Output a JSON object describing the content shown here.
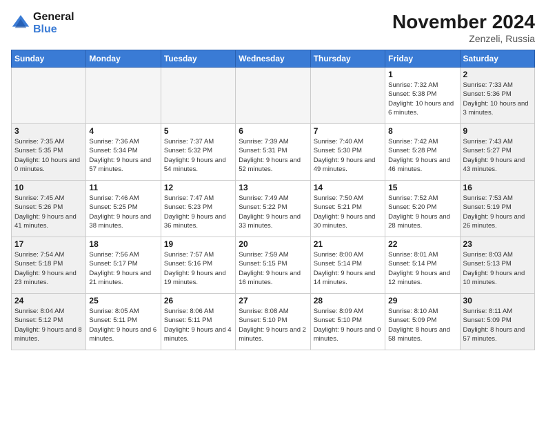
{
  "header": {
    "logo_line1": "General",
    "logo_line2": "Blue",
    "month": "November 2024",
    "location": "Zenzeli, Russia"
  },
  "weekdays": [
    "Sunday",
    "Monday",
    "Tuesday",
    "Wednesday",
    "Thursday",
    "Friday",
    "Saturday"
  ],
  "weeks": [
    [
      {
        "day": "",
        "empty": true
      },
      {
        "day": "",
        "empty": true
      },
      {
        "day": "",
        "empty": true
      },
      {
        "day": "",
        "empty": true
      },
      {
        "day": "",
        "empty": true
      },
      {
        "day": "1",
        "sunrise": "Sunrise: 7:32 AM",
        "sunset": "Sunset: 5:38 PM",
        "daylight": "Daylight: 10 hours and 6 minutes."
      },
      {
        "day": "2",
        "sunrise": "Sunrise: 7:33 AM",
        "sunset": "Sunset: 5:36 PM",
        "daylight": "Daylight: 10 hours and 3 minutes."
      }
    ],
    [
      {
        "day": "3",
        "sunrise": "Sunrise: 7:35 AM",
        "sunset": "Sunset: 5:35 PM",
        "daylight": "Daylight: 10 hours and 0 minutes."
      },
      {
        "day": "4",
        "sunrise": "Sunrise: 7:36 AM",
        "sunset": "Sunset: 5:34 PM",
        "daylight": "Daylight: 9 hours and 57 minutes."
      },
      {
        "day": "5",
        "sunrise": "Sunrise: 7:37 AM",
        "sunset": "Sunset: 5:32 PM",
        "daylight": "Daylight: 9 hours and 54 minutes."
      },
      {
        "day": "6",
        "sunrise": "Sunrise: 7:39 AM",
        "sunset": "Sunset: 5:31 PM",
        "daylight": "Daylight: 9 hours and 52 minutes."
      },
      {
        "day": "7",
        "sunrise": "Sunrise: 7:40 AM",
        "sunset": "Sunset: 5:30 PM",
        "daylight": "Daylight: 9 hours and 49 minutes."
      },
      {
        "day": "8",
        "sunrise": "Sunrise: 7:42 AM",
        "sunset": "Sunset: 5:28 PM",
        "daylight": "Daylight: 9 hours and 46 minutes."
      },
      {
        "day": "9",
        "sunrise": "Sunrise: 7:43 AM",
        "sunset": "Sunset: 5:27 PM",
        "daylight": "Daylight: 9 hours and 43 minutes."
      }
    ],
    [
      {
        "day": "10",
        "sunrise": "Sunrise: 7:45 AM",
        "sunset": "Sunset: 5:26 PM",
        "daylight": "Daylight: 9 hours and 41 minutes."
      },
      {
        "day": "11",
        "sunrise": "Sunrise: 7:46 AM",
        "sunset": "Sunset: 5:25 PM",
        "daylight": "Daylight: 9 hours and 38 minutes."
      },
      {
        "day": "12",
        "sunrise": "Sunrise: 7:47 AM",
        "sunset": "Sunset: 5:23 PM",
        "daylight": "Daylight: 9 hours and 36 minutes."
      },
      {
        "day": "13",
        "sunrise": "Sunrise: 7:49 AM",
        "sunset": "Sunset: 5:22 PM",
        "daylight": "Daylight: 9 hours and 33 minutes."
      },
      {
        "day": "14",
        "sunrise": "Sunrise: 7:50 AM",
        "sunset": "Sunset: 5:21 PM",
        "daylight": "Daylight: 9 hours and 30 minutes."
      },
      {
        "day": "15",
        "sunrise": "Sunrise: 7:52 AM",
        "sunset": "Sunset: 5:20 PM",
        "daylight": "Daylight: 9 hours and 28 minutes."
      },
      {
        "day": "16",
        "sunrise": "Sunrise: 7:53 AM",
        "sunset": "Sunset: 5:19 PM",
        "daylight": "Daylight: 9 hours and 26 minutes."
      }
    ],
    [
      {
        "day": "17",
        "sunrise": "Sunrise: 7:54 AM",
        "sunset": "Sunset: 5:18 PM",
        "daylight": "Daylight: 9 hours and 23 minutes."
      },
      {
        "day": "18",
        "sunrise": "Sunrise: 7:56 AM",
        "sunset": "Sunset: 5:17 PM",
        "daylight": "Daylight: 9 hours and 21 minutes."
      },
      {
        "day": "19",
        "sunrise": "Sunrise: 7:57 AM",
        "sunset": "Sunset: 5:16 PM",
        "daylight": "Daylight: 9 hours and 19 minutes."
      },
      {
        "day": "20",
        "sunrise": "Sunrise: 7:59 AM",
        "sunset": "Sunset: 5:15 PM",
        "daylight": "Daylight: 9 hours and 16 minutes."
      },
      {
        "day": "21",
        "sunrise": "Sunrise: 8:00 AM",
        "sunset": "Sunset: 5:14 PM",
        "daylight": "Daylight: 9 hours and 14 minutes."
      },
      {
        "day": "22",
        "sunrise": "Sunrise: 8:01 AM",
        "sunset": "Sunset: 5:14 PM",
        "daylight": "Daylight: 9 hours and 12 minutes."
      },
      {
        "day": "23",
        "sunrise": "Sunrise: 8:03 AM",
        "sunset": "Sunset: 5:13 PM",
        "daylight": "Daylight: 9 hours and 10 minutes."
      }
    ],
    [
      {
        "day": "24",
        "sunrise": "Sunrise: 8:04 AM",
        "sunset": "Sunset: 5:12 PM",
        "daylight": "Daylight: 9 hours and 8 minutes."
      },
      {
        "day": "25",
        "sunrise": "Sunrise: 8:05 AM",
        "sunset": "Sunset: 5:11 PM",
        "daylight": "Daylight: 9 hours and 6 minutes."
      },
      {
        "day": "26",
        "sunrise": "Sunrise: 8:06 AM",
        "sunset": "Sunset: 5:11 PM",
        "daylight": "Daylight: 9 hours and 4 minutes."
      },
      {
        "day": "27",
        "sunrise": "Sunrise: 8:08 AM",
        "sunset": "Sunset: 5:10 PM",
        "daylight": "Daylight: 9 hours and 2 minutes."
      },
      {
        "day": "28",
        "sunrise": "Sunrise: 8:09 AM",
        "sunset": "Sunset: 5:10 PM",
        "daylight": "Daylight: 9 hours and 0 minutes."
      },
      {
        "day": "29",
        "sunrise": "Sunrise: 8:10 AM",
        "sunset": "Sunset: 5:09 PM",
        "daylight": "Daylight: 8 hours and 58 minutes."
      },
      {
        "day": "30",
        "sunrise": "Sunrise: 8:11 AM",
        "sunset": "Sunset: 5:09 PM",
        "daylight": "Daylight: 8 hours and 57 minutes."
      }
    ]
  ]
}
